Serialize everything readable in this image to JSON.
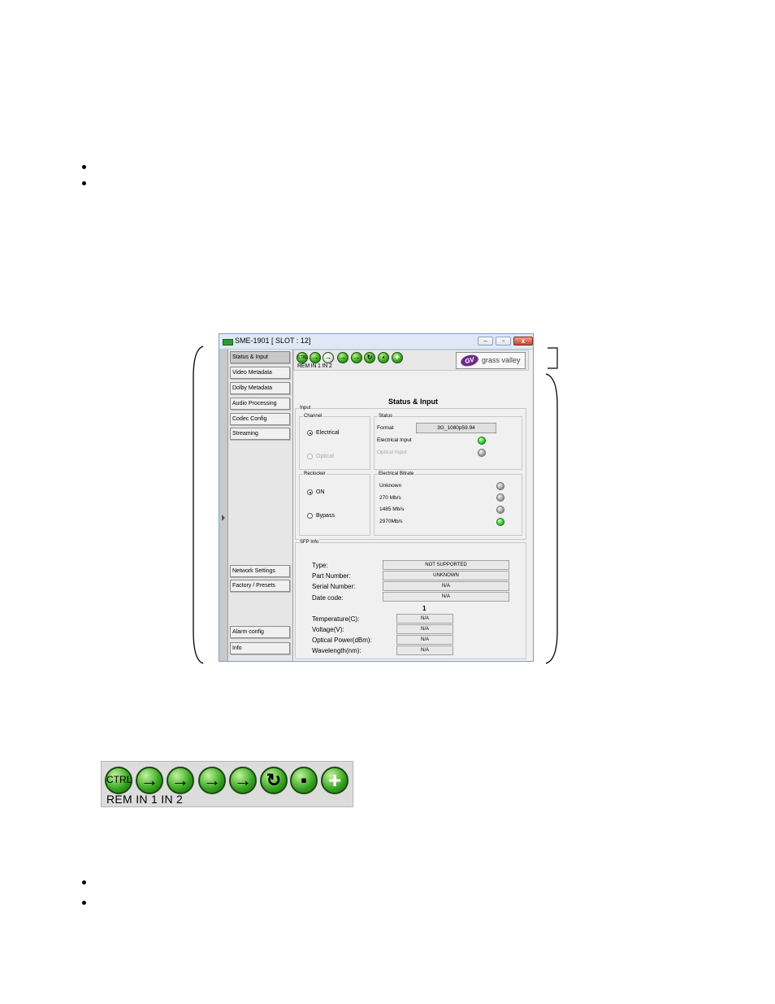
{
  "window": {
    "title": "SME-1901 [ SLOT : 12]",
    "controls": {
      "minimize": "–",
      "maximize": "▫",
      "close": "x"
    }
  },
  "nav": {
    "items": [
      {
        "label": "Status & Input"
      },
      {
        "label": "Video Metadata"
      },
      {
        "label": "Dolby Metadata"
      },
      {
        "label": "Audio Processing"
      },
      {
        "label": "Codec Config"
      },
      {
        "label": "Streaming"
      },
      {
        "label": "Network Settings"
      },
      {
        "label": "Factory / Presets"
      },
      {
        "label": "Alarm config"
      },
      {
        "label": "Info"
      }
    ]
  },
  "toolbar": {
    "ctrl_text": "CTRL",
    "labels": "REM IN 1  IN 2",
    "icons": [
      "ctrl-icon",
      "input1-arrow-icon",
      "input2-arrow-icon",
      "output-arrow-icon",
      "output2-arrow-icon",
      "reference-icon",
      "network-icon",
      "plus-icon"
    ]
  },
  "logo": {
    "mark": "GV",
    "text": "grass valley"
  },
  "page_title": "Status & Input",
  "input": {
    "legend": "Input",
    "channel": {
      "legend": "Channel",
      "electrical": "Electrical",
      "optical": "Optical",
      "selected": "Electrical"
    },
    "status": {
      "legend": "Status",
      "format_label": "Format",
      "format_value": "3G_1080p59.94",
      "electrical_input": "Electrical Input",
      "optical_input": "Optical Input",
      "electrical_led": "green",
      "optical_led": "grey"
    },
    "reclocker": {
      "legend": "Reclocker",
      "on": "ON",
      "bypass": "Bypass",
      "selected": "ON"
    },
    "bitrate": {
      "legend": "Electrical Bitrate",
      "items": [
        {
          "label": "Unknown",
          "led": "grey"
        },
        {
          "label": "270 Mb/s",
          "led": "grey"
        },
        {
          "label": "1485 Mb/s",
          "led": "grey"
        },
        {
          "label": "2970Mb/s",
          "led": "green"
        }
      ]
    }
  },
  "sfp": {
    "legend": "SFP Info",
    "rows": [
      {
        "label": "Type:",
        "value": "NOT SUPPORTED"
      },
      {
        "label": "Part Number:",
        "value": "UNKNOWN"
      },
      {
        "label": "Serial Number:",
        "value": "N/A"
      },
      {
        "label": "Date code:",
        "value": "N/A"
      }
    ],
    "channel_number": "1",
    "diag": [
      {
        "label": "Temperature(C):",
        "value": "N/A"
      },
      {
        "label": "Voltage(V):",
        "value": "N/A"
      },
      {
        "label": "Optical Power(dBm):",
        "value": "N/A"
      },
      {
        "label": "Wavelength(nm):",
        "value": "N/A"
      }
    ]
  },
  "big_toolbar": {
    "ctrl_text": "CTRL",
    "labels": "REM  IN 1   IN 2"
  },
  "colors": {
    "led_green": "#2fd12f",
    "led_grey": "#a8a8a8",
    "icon_green": "#34a21e",
    "logo_purple": "#6b2a8a"
  }
}
